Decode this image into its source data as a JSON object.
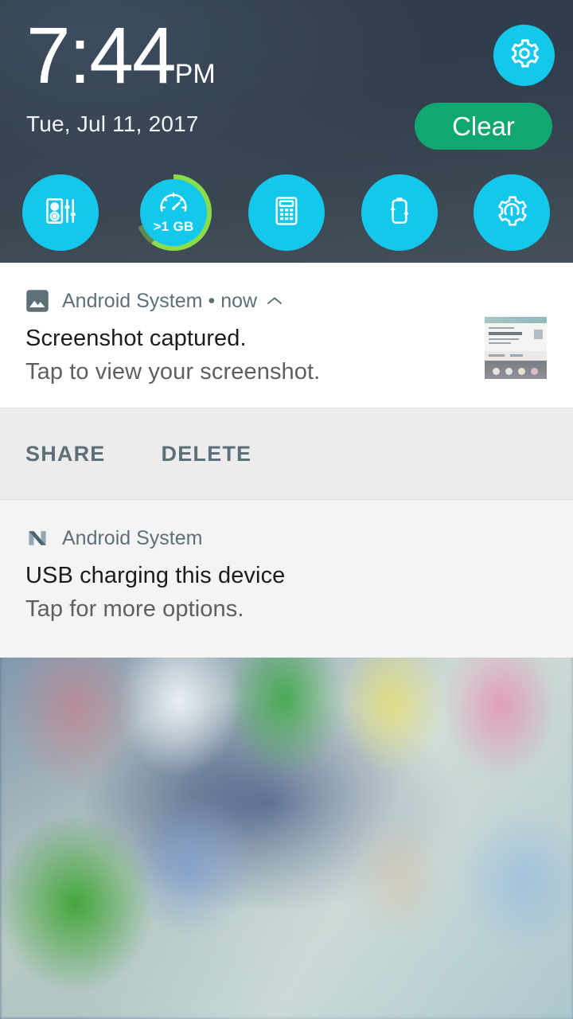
{
  "status_panel": {
    "time": "7:44",
    "ampm": "PM",
    "date": "Tue, Jul 11, 2017",
    "settings_icon": "gear-icon",
    "clear_label": "Clear",
    "accent_cyan": "#14c8ec",
    "accent_green": "#10a771",
    "ring_green": "#8bdc4a",
    "panel_bg": "#313e4c"
  },
  "quick_settings": {
    "tiles": [
      {
        "name": "audio-equalizer-tile",
        "icon": "speaker-equalizer-icon",
        "label": ""
      },
      {
        "name": "memory-boost-tile",
        "icon": "speedometer-icon",
        "label": ">1 GB"
      },
      {
        "name": "calculator-tile",
        "icon": "calculator-icon",
        "label": ""
      },
      {
        "name": "battery-saver-tile",
        "icon": "battery-cycle-icon",
        "label": ""
      },
      {
        "name": "performance-settings-tile",
        "icon": "gear-gauge-icon",
        "label": ""
      }
    ]
  },
  "notifications": [
    {
      "app": "Android System",
      "separator": "•",
      "time": "now",
      "expand_icon": "chevron-up-icon",
      "app_icon": "photo-image-icon",
      "title": "Screenshot captured.",
      "body": "Tap to view your screenshot.",
      "thumbnail": "screenshot-thumbnail",
      "actions": [
        {
          "name": "share-button",
          "label": "SHARE"
        },
        {
          "name": "delete-button",
          "label": "DELETE"
        }
      ]
    },
    {
      "app": "Android System",
      "app_icon": "android-nougat-logo-icon",
      "title": "USB charging this device",
      "body": "Tap for more options."
    }
  ]
}
